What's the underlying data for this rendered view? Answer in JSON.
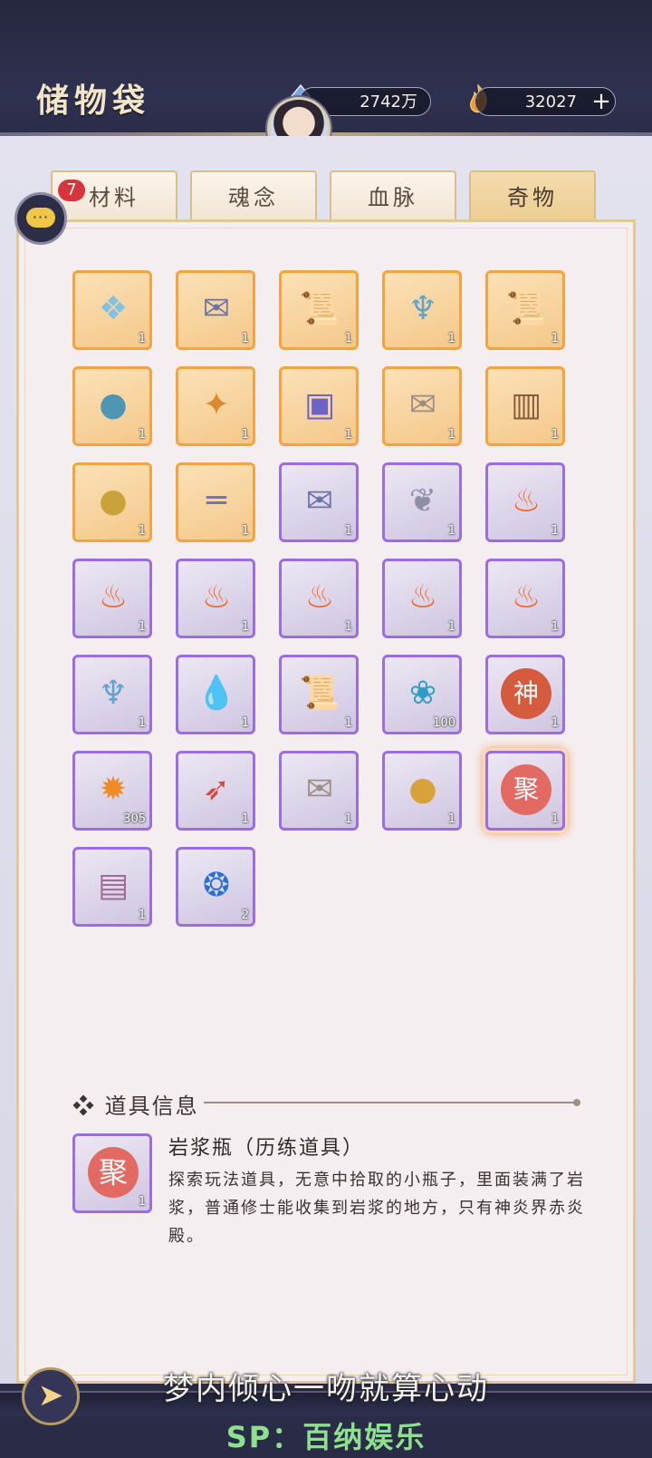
{
  "header": {
    "title": "储物袋",
    "currency1": "2742万",
    "currency2": "32027",
    "plus_label": "+"
  },
  "tabs": [
    {
      "label": "材料",
      "badge": "7",
      "active": false
    },
    {
      "label": "魂念",
      "active": false
    },
    {
      "label": "血脉",
      "active": false
    },
    {
      "label": "奇物",
      "active": true
    }
  ],
  "chat": {
    "label": "···"
  },
  "grid": {
    "items": [
      {
        "icon": "blue-shards-icon",
        "rarity": "orange",
        "count": "1"
      },
      {
        "icon": "talisman-paper-icon",
        "rarity": "orange",
        "count": "1"
      },
      {
        "icon": "scroll-icon",
        "rarity": "orange",
        "count": "1"
      },
      {
        "icon": "fish-pendant-icon",
        "rarity": "orange",
        "count": "1"
      },
      {
        "icon": "scroll-icon",
        "rarity": "orange",
        "count": "1"
      },
      {
        "icon": "pouch-icon",
        "rarity": "orange",
        "count": "1"
      },
      {
        "icon": "amulet-tag-icon",
        "rarity": "orange",
        "count": "1"
      },
      {
        "icon": "book-icon",
        "rarity": "orange",
        "count": "1"
      },
      {
        "icon": "letter-icon",
        "rarity": "orange",
        "count": "1"
      },
      {
        "icon": "painting-icon",
        "rarity": "orange",
        "count": "1"
      },
      {
        "icon": "bell-icon",
        "rarity": "orange",
        "count": "1"
      },
      {
        "icon": "rolled-scroll-icon",
        "rarity": "orange",
        "count": "1"
      },
      {
        "icon": "talisman-paper-icon",
        "rarity": "purple",
        "count": "1"
      },
      {
        "icon": "wings-icon",
        "rarity": "purple",
        "count": "1"
      },
      {
        "icon": "flame-icon",
        "rarity": "purple",
        "count": "1"
      },
      {
        "icon": "flame-icon",
        "rarity": "purple",
        "count": "1"
      },
      {
        "icon": "flame-icon",
        "rarity": "purple",
        "count": "1"
      },
      {
        "icon": "flame-icon",
        "rarity": "purple",
        "count": "1"
      },
      {
        "icon": "flame-icon",
        "rarity": "purple",
        "count": "1"
      },
      {
        "icon": "flame-icon",
        "rarity": "purple",
        "count": "1"
      },
      {
        "icon": "fish-pendant-icon",
        "rarity": "purple",
        "count": "1"
      },
      {
        "icon": "water-drop-icon",
        "rarity": "purple",
        "count": "1"
      },
      {
        "icon": "scroll-icon",
        "rarity": "purple",
        "count": "1"
      },
      {
        "icon": "water-spirit-icon",
        "rarity": "purple",
        "count": "100"
      },
      {
        "icon": "god-seal-icon",
        "rarity": "purple",
        "count": "1"
      },
      {
        "icon": "fire-orb-icon",
        "rarity": "purple",
        "count": "305"
      },
      {
        "icon": "feather-icon",
        "rarity": "purple",
        "count": "1"
      },
      {
        "icon": "letter-icon",
        "rarity": "purple",
        "count": "1"
      },
      {
        "icon": "gourd-icon",
        "rarity": "purple",
        "count": "1"
      },
      {
        "icon": "magma-bottle-icon",
        "rarity": "purple",
        "count": "1",
        "selected": true
      },
      {
        "icon": "map-scroll-icon",
        "rarity": "purple",
        "count": "1"
      },
      {
        "icon": "paw-orb-icon",
        "rarity": "purple",
        "count": "2"
      }
    ],
    "god_seal_text": "神",
    "bottle_text": "聚"
  },
  "info": {
    "heading": "道具信息",
    "heading_mark": "❖",
    "item_count": "1",
    "item_title": "岩浆瓶（历练道具）",
    "item_desc": "探索玩法道具，无意中拾取的小瓶子，里面装满了岩浆，普通修士能收集到岩浆的地方，只有神炎界赤炎殿。"
  },
  "overlay": {
    "subtitle": "梦内倾心一吻就算心动",
    "watermark": "SP：百纳娱乐"
  },
  "colors": {
    "orange_border": "#f3a441",
    "purple_border": "#9a6ee0",
    "badge": "#d8343b",
    "watermark": "#8ee08e"
  }
}
